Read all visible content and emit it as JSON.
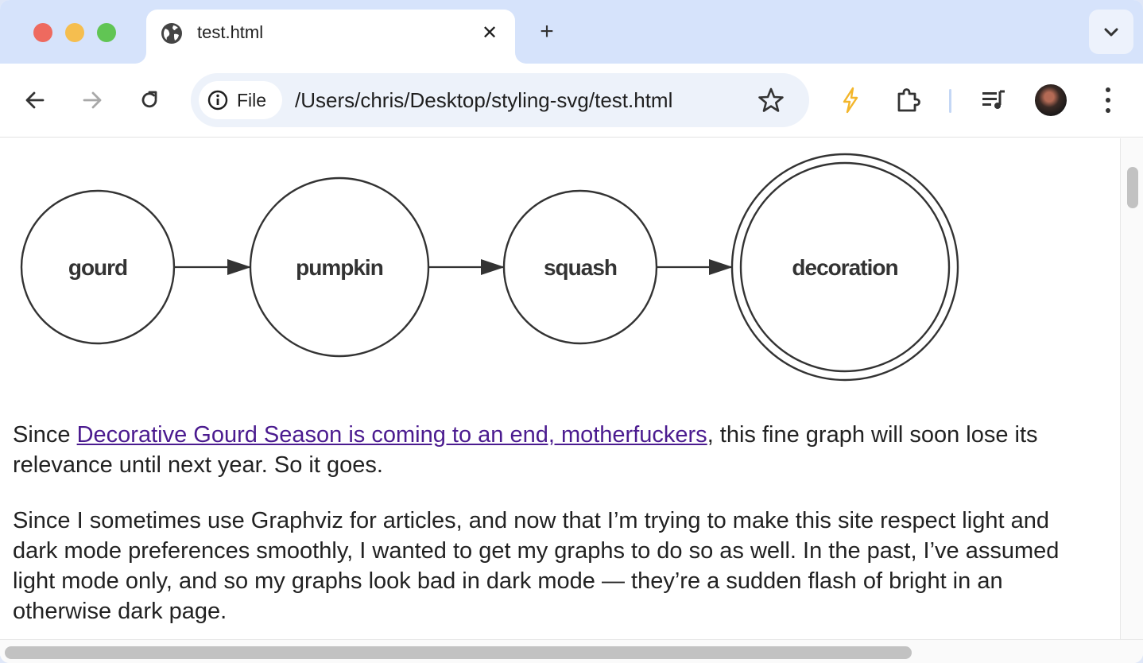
{
  "browser": {
    "tab": {
      "title": "test.html",
      "icon": "globe-icon"
    },
    "toolbar": {
      "security_chip_label": "File",
      "url": "/Users/chris/Desktop/styling-svg/test.html"
    }
  },
  "colors": {
    "link": "#4b1b8f",
    "text": "#222222",
    "tabstrip": "#d6e3fb"
  },
  "graph": {
    "nodes": [
      {
        "id": "gourd",
        "label": "gourd",
        "shape": "circle"
      },
      {
        "id": "pumpkin",
        "label": "pumpkin",
        "shape": "circle"
      },
      {
        "id": "squash",
        "label": "squash",
        "shape": "circle"
      },
      {
        "id": "decoration",
        "label": "decoration",
        "shape": "doublecircle"
      }
    ],
    "edges": [
      [
        "gourd",
        "pumpkin"
      ],
      [
        "pumpkin",
        "squash"
      ],
      [
        "squash",
        "decoration"
      ]
    ]
  },
  "article": {
    "p1_prefix": "Since ",
    "p1_link": "Decorative Gourd Season is coming to an end, motherfuckers",
    "p1_suffix": ", this fine graph will soon lose its relevance until next year. So it goes.",
    "p2": "Since I sometimes use Graphviz for articles, and now that I’m trying to make this site respect light and dark mode preferences smoothly, I wanted to get my graphs to do so as well. In the past, I’ve assumed light mode only, and so my graphs look bad in dark mode — they’re a sudden flash of bright in an otherwise dark page."
  }
}
